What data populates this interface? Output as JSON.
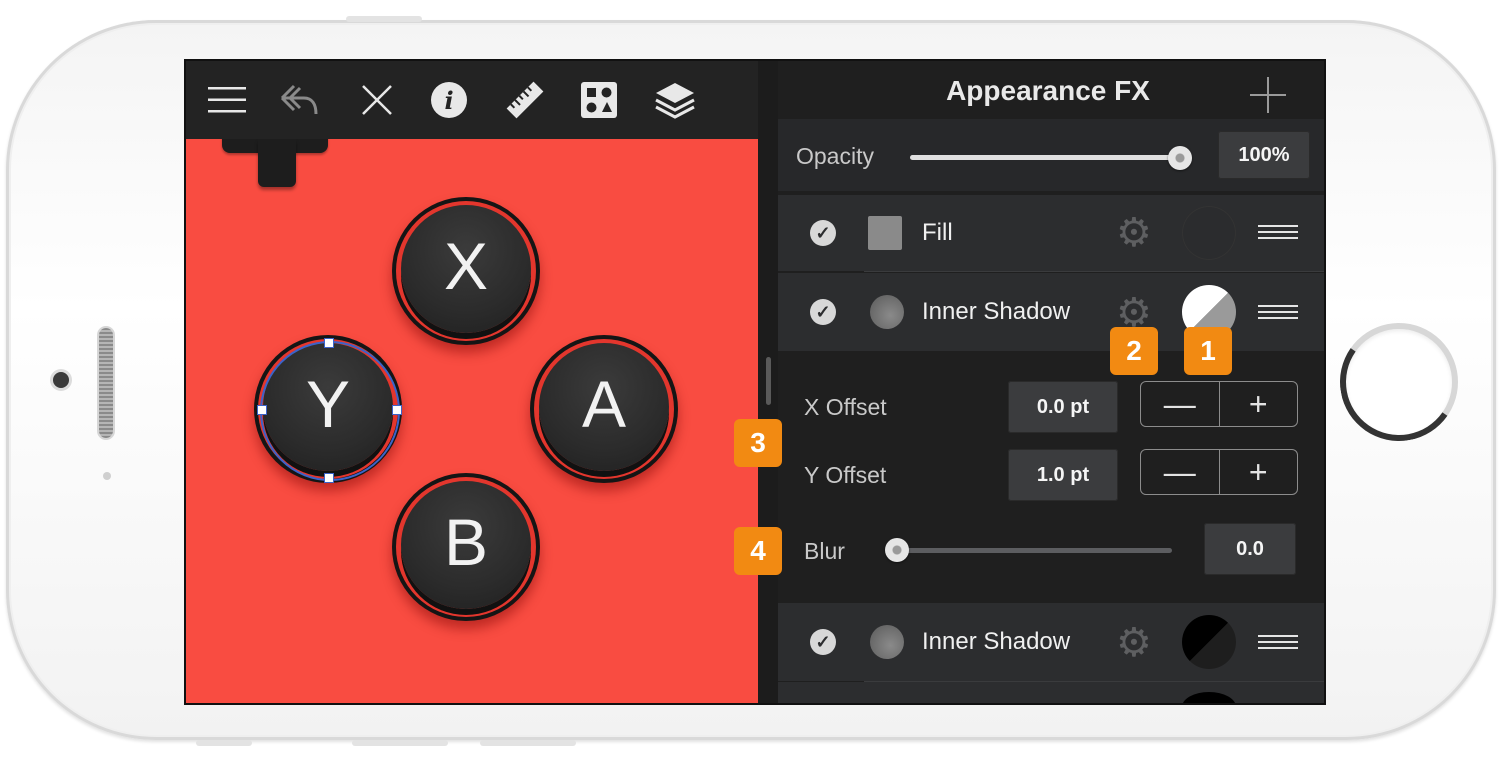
{
  "panel": {
    "title": "Appearance FX",
    "opacity": {
      "label": "Opacity",
      "value": "100%",
      "level": 1.0
    },
    "effects": [
      {
        "label": "Fill",
        "enabled": true
      },
      {
        "label": "Inner Shadow",
        "enabled": true
      },
      {
        "label": "Inner Shadow",
        "enabled": true
      }
    ],
    "x_offset": {
      "label": "X Offset",
      "value": "0.0 pt",
      "minus": "—",
      "plus": "+"
    },
    "y_offset": {
      "label": "Y Offset",
      "value": "1.0 pt",
      "minus": "—",
      "plus": "+"
    },
    "blur": {
      "label": "Blur",
      "value": "0.0",
      "level": 0.0
    }
  },
  "canvas": {
    "buttons": [
      "X",
      "Y",
      "A",
      "B"
    ]
  },
  "callouts": [
    "1",
    "2",
    "3",
    "4"
  ],
  "toolbar_icons": [
    "menu-icon",
    "undo-icon",
    "close-icon",
    "info-icon",
    "ruler-icon",
    "shapes-icon",
    "layers-icon"
  ],
  "colors": {
    "accent": "#f28a12",
    "canvas_red": "#f94c41",
    "selection": "#3c63c9"
  }
}
